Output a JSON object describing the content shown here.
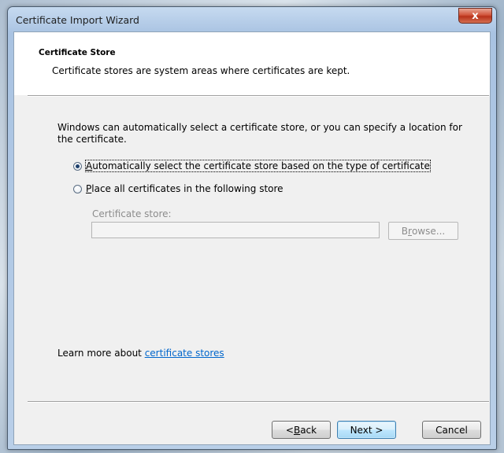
{
  "window": {
    "title": "Certificate Import Wizard",
    "close_glyph": "x"
  },
  "header": {
    "title": "Certificate Store",
    "description": "Certificate stores are system areas where certificates are kept."
  },
  "body": {
    "intro": "Windows can automatically select a certificate store, or you can specify a location for the certificate.",
    "options": [
      {
        "mnemonic": "A",
        "rest": "utomatically select the certificate store based on the type of certificate",
        "checked": true
      },
      {
        "mnemonic": "P",
        "rest": "lace all certificates in the following store",
        "checked": false
      }
    ],
    "store_label": "Certificate store:",
    "store_value": "",
    "browse": {
      "pre": "B",
      "mnemonic": "r",
      "post": "owse..."
    }
  },
  "footer": {
    "learn_prefix": "Learn more about ",
    "learn_link": "certificate stores",
    "back": {
      "pre": "< ",
      "mnemonic": "B",
      "post": "ack"
    },
    "next_label": "Next >",
    "cancel_label": "Cancel"
  }
}
